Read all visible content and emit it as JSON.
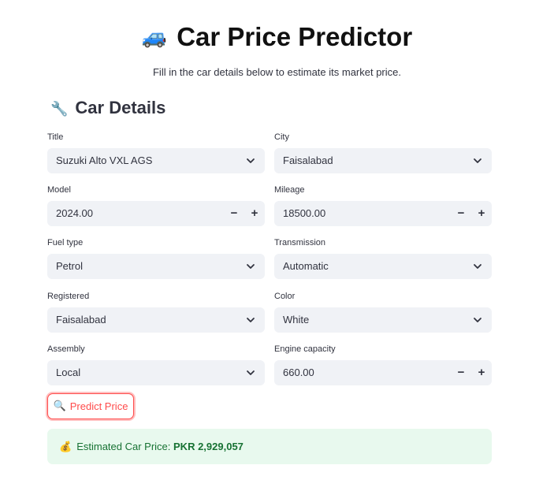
{
  "header": {
    "title_icon": "🚙",
    "title": "Car Price Predictor",
    "subtitle": "Fill in the car details below to estimate its market price."
  },
  "section": {
    "icon": "🔧",
    "title": "Car Details"
  },
  "fields": {
    "title": {
      "label": "Title",
      "value": "Suzuki Alto VXL AGS",
      "kind": "select"
    },
    "city": {
      "label": "City",
      "value": "Faisalabad",
      "kind": "select"
    },
    "model": {
      "label": "Model",
      "value": "2024.00",
      "kind": "number"
    },
    "mileage": {
      "label": "Mileage",
      "value": "18500.00",
      "kind": "number"
    },
    "fuel_type": {
      "label": "Fuel type",
      "value": "Petrol",
      "kind": "select"
    },
    "transmission": {
      "label": "Transmission",
      "value": "Automatic",
      "kind": "select"
    },
    "registered": {
      "label": "Registered",
      "value": "Faisalabad",
      "kind": "select"
    },
    "color": {
      "label": "Color",
      "value": "White",
      "kind": "select"
    },
    "assembly": {
      "label": "Assembly",
      "value": "Local",
      "kind": "select"
    },
    "engine_capacity": {
      "label": "Engine capacity",
      "value": "660.00",
      "kind": "number"
    }
  },
  "stepper": {
    "minus": "−",
    "plus": "+"
  },
  "predict_button": {
    "icon": "🔍",
    "label": "Predict Price"
  },
  "result": {
    "icon": "💰",
    "label": "Estimated Car Price:",
    "value": "PKR 2,929,057"
  },
  "colors": {
    "accent": "#ff4b4b",
    "input_bg": "#f0f2f6",
    "success_bg": "#e8f9ee",
    "success_text": "#177233"
  }
}
